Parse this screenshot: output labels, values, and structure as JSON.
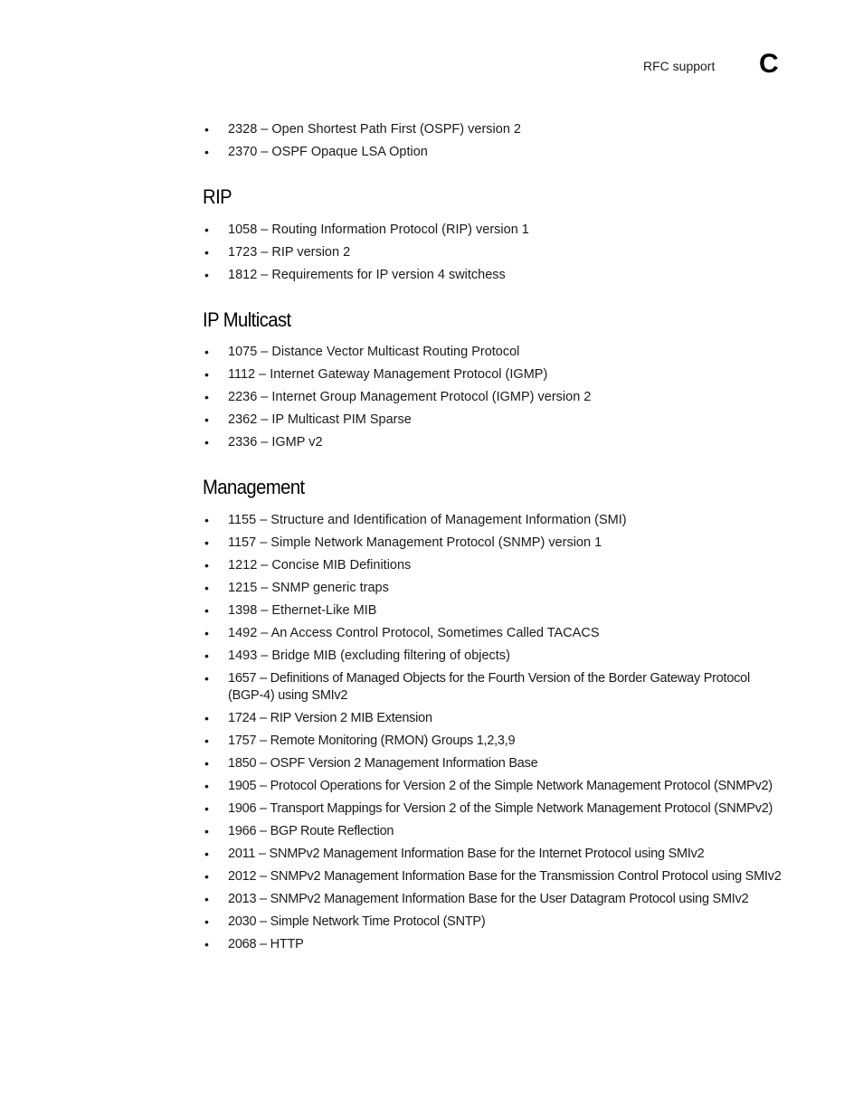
{
  "header": {
    "label": "RFC support",
    "appendix_letter": "C"
  },
  "sections": [
    {
      "title": "",
      "items": [
        "2328 – Open Shortest Path First (OSPF) version 2",
        "2370 – OSPF Opaque LSA Option"
      ]
    },
    {
      "title": "RIP",
      "items": [
        "1058 – Routing Information Protocol (RIP) version 1",
        "1723 – RIP version 2",
        "1812 – Requirements for IP version 4 switchess"
      ]
    },
    {
      "title": "IP Multicast",
      "items": [
        "1075 – Distance Vector Multicast Routing Protocol",
        "1112 – Internet Gateway Management Protocol (IGMP)",
        "2236  – Internet Group Management Protocol (IGMP) version 2",
        "2362 – IP Multicast PIM Sparse",
        "2336 – IGMP v2"
      ]
    },
    {
      "title": "Management",
      "items": [
        "1155 – Structure and Identification of Management Information (SMI)",
        "1157 – Simple Network Management Protocol (SNMP) version 1",
        "1212 – Concise MIB Definitions",
        "1215 – SNMP generic traps",
        "1398 – Ethernet-Like MIB",
        "1492 – An Access Control Protocol, Sometimes Called TACACS",
        "1493 – Bridge MIB (excluding filtering of objects)",
        "1657 – Definitions of Managed Objects for the Fourth Version of the Border Gateway Protocol (BGP-4) using SMIv2",
        "1724 – RIP Version 2 MIB Extension",
        "1757 – Remote Monitoring (RMON) Groups 1,2,3,9",
        "1850 – OSPF Version 2 Management Information Base",
        "1905 – Protocol Operations for Version 2 of the Simple Network Management Protocol (SNMPv2)",
        "1906 – Transport Mappings for Version 2 of the Simple Network Management Protocol (SNMPv2)",
        "1966 – BGP Route Reflection",
        "2011 – SNMPv2 Management Information Base for the Internet Protocol using SMIv2",
        "2012 – SNMPv2 Management Information Base for the Transmission Control Protocol using SMIv2",
        "2013 – SNMPv2 Management Information Base for the User Datagram Protocol using SMIv2",
        "2030 – Simple Network Time Protocol (SNTP)",
        "2068 – HTTP"
      ]
    }
  ]
}
